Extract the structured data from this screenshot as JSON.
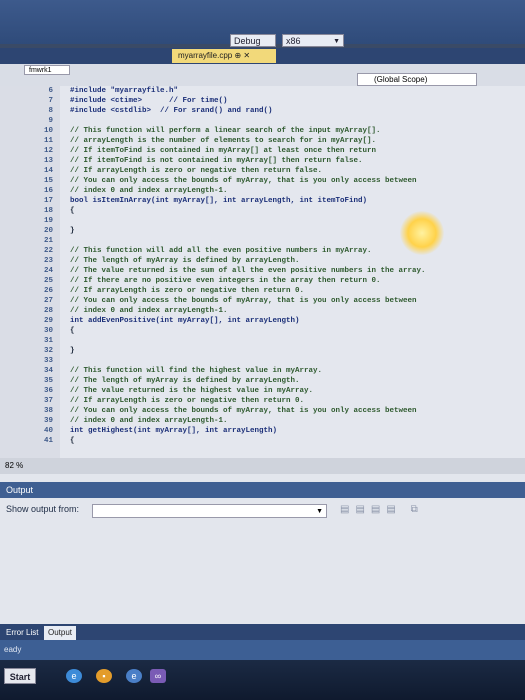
{
  "toolbar": {
    "config": "Debug",
    "platform": "x86"
  },
  "tabs": [
    {
      "label": "myarrayfile.cpp  ⊕ ✕"
    }
  ],
  "navbar": {
    "scope": "fmwrk1",
    "right_scope": "(Global Scope)"
  },
  "editor": {
    "lines": [
      {
        "n": "6",
        "t": "#include \"myarrayfile.h\"",
        "c": "kw"
      },
      {
        "n": "7",
        "t": "#include <ctime>      // For time()",
        "c": "kw"
      },
      {
        "n": "8",
        "t": "#include <cstdlib>  // For srand() and rand()",
        "c": "kw"
      },
      {
        "n": "9",
        "t": "",
        "c": ""
      },
      {
        "n": "10",
        "t": "// This function will perform a linear search of the input myArray[].",
        "c": "cm"
      },
      {
        "n": "11",
        "t": "// arrayLength is the number of elements to search for in myArray[].",
        "c": "cm"
      },
      {
        "n": "12",
        "t": "// If itemToFind is contained in myArray[] at least once then return",
        "c": "cm"
      },
      {
        "n": "13",
        "t": "// If itemToFind is not contained in myArray[] then return false.",
        "c": "cm"
      },
      {
        "n": "14",
        "t": "// If arrayLength is zero or negative then return false.",
        "c": "cm"
      },
      {
        "n": "15",
        "t": "// You can only access the bounds of myArray, that is you only access between",
        "c": "cm"
      },
      {
        "n": "16",
        "t": "// index 0 and index arrayLength-1.",
        "c": "cm"
      },
      {
        "n": "17",
        "t": "bool isItemInArray(int myArray[], int arrayLength, int itemToFind)",
        "c": "kw"
      },
      {
        "n": "18",
        "t": "{",
        "c": ""
      },
      {
        "n": "19",
        "t": "",
        "c": ""
      },
      {
        "n": "20",
        "t": "}",
        "c": ""
      },
      {
        "n": "21",
        "t": "",
        "c": ""
      },
      {
        "n": "22",
        "t": "// This function will add all the even positive numbers in myArray.",
        "c": "cm"
      },
      {
        "n": "23",
        "t": "// The length of myArray is defined by arrayLength.",
        "c": "cm"
      },
      {
        "n": "24",
        "t": "// The value returned is the sum of all the even positive numbers in the array.",
        "c": "cm"
      },
      {
        "n": "25",
        "t": "// If there are no positive even integers in the array then return 0.",
        "c": "cm"
      },
      {
        "n": "26",
        "t": "// If arrayLength is zero or negative then return 0.",
        "c": "cm"
      },
      {
        "n": "27",
        "t": "// You can only access the bounds of myArray, that is you only access between",
        "c": "cm"
      },
      {
        "n": "28",
        "t": "// index 0 and index arrayLength-1.",
        "c": "cm"
      },
      {
        "n": "29",
        "t": "int addEvenPositive(int myArray[], int arrayLength)",
        "c": "kw"
      },
      {
        "n": "30",
        "t": "{",
        "c": ""
      },
      {
        "n": "31",
        "t": "",
        "c": ""
      },
      {
        "n": "32",
        "t": "}",
        "c": ""
      },
      {
        "n": "33",
        "t": "",
        "c": ""
      },
      {
        "n": "34",
        "t": "// This function will find the highest value in myArray.",
        "c": "cm"
      },
      {
        "n": "35",
        "t": "// The length of myArray is defined by arrayLength.",
        "c": "cm"
      },
      {
        "n": "36",
        "t": "// The value returned is the highest value in myArray.",
        "c": "cm"
      },
      {
        "n": "37",
        "t": "// If arrayLength is zero or negative then return 0.",
        "c": "cm"
      },
      {
        "n": "38",
        "t": "// You can only access the bounds of myArray, that is you only access between",
        "c": "cm"
      },
      {
        "n": "39",
        "t": "// index 0 and index arrayLength-1.",
        "c": "cm"
      },
      {
        "n": "40",
        "t": "int getHighest(int myArray[], int arrayLength)",
        "c": "kw"
      },
      {
        "n": "41",
        "t": "{",
        "c": ""
      }
    ]
  },
  "zoom": "82 %",
  "output": {
    "title": "Output",
    "show_from_label": "Show output from:"
  },
  "bottom_tabs": [
    {
      "label": "Error List"
    },
    {
      "label": "Output"
    }
  ],
  "status": "eady",
  "taskbar": {
    "start": "Start"
  }
}
